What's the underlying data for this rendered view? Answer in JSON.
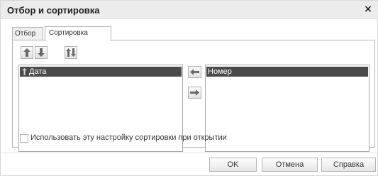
{
  "window": {
    "title": "Отбор и сортировка",
    "close_label": "×"
  },
  "tabs": [
    {
      "label": "Отбор",
      "active": false
    },
    {
      "label": "Сортировка",
      "active": true
    }
  ],
  "toolbar": {
    "icons": [
      "arrow-up-icon",
      "arrow-down-icon",
      "sort-direction-icon"
    ]
  },
  "left_list": {
    "items": [
      {
        "label": "Дата",
        "selected": true,
        "icon": "sort-field-icon"
      }
    ]
  },
  "right_list": {
    "items": [
      {
        "label": "Номер",
        "selected": true
      }
    ]
  },
  "move_buttons": {
    "icons": [
      "arrow-left-icon",
      "arrow-right-icon"
    ]
  },
  "option": {
    "label": "Использовать эту настройку сортировки при открытии",
    "checked": false
  },
  "buttons": {
    "ok": "OK",
    "cancel": "Отмена",
    "help": "Справка"
  },
  "colors": {
    "selection": "#4a4a4a",
    "titlebar": "#ececec"
  }
}
